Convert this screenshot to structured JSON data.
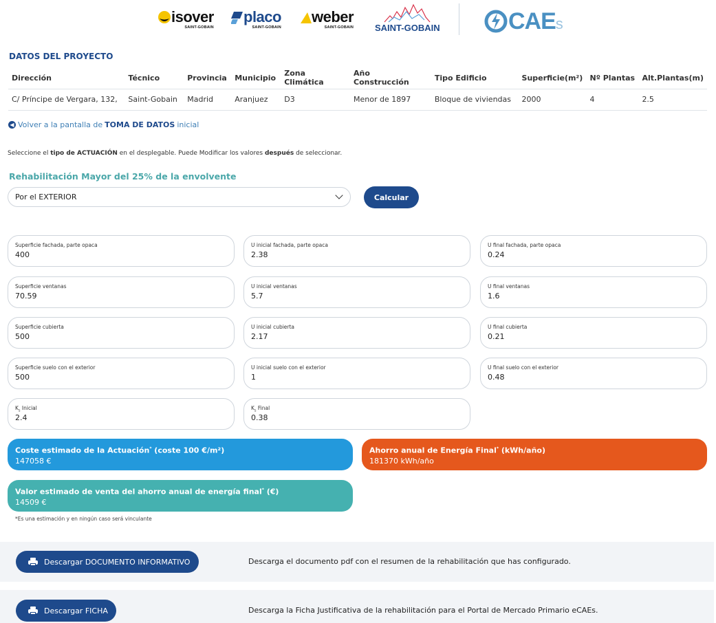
{
  "logos": {
    "isover": "isover",
    "placo": "placo",
    "weber": "weber",
    "saint_gobain_sub": "SAINT-GOBAIN",
    "saint_gobain": "SAINT-GOBAIN",
    "caes": "CAE",
    "caes_suffix": "s"
  },
  "project": {
    "title": "DATOS DEL PROYECTO",
    "headers": [
      "Dirección",
      "Técnico",
      "Provincia",
      "Municipio",
      "Zona Climática",
      "Año Construcción",
      "Tipo Edificio",
      "Superficie(m²)",
      "Nº Plantas",
      "Alt.Plantas(m)"
    ],
    "row": [
      "C/ Príncipe de Vergara, 132,",
      "Saint-Gobain",
      "Madrid",
      "Aranjuez",
      "D3",
      "Menor de 1897",
      "Bloque de viviendas",
      "2000",
      "4",
      "2.5"
    ]
  },
  "back_link": {
    "prefix": "Volver a la pantalla de",
    "bold": "TOMA DE DATOS",
    "suffix": "inicial"
  },
  "instructions": {
    "p1": "Seleccione el",
    "b1": "tipo de ACTUACIÓN",
    "p2": "en el desplegable. Puede Modificar los valores",
    "b2": "después",
    "p3": "de seleccionar."
  },
  "subtitle": "Rehabilitación Mayor del 25% de la envolvente",
  "select": {
    "value": "Por el EXTERIOR"
  },
  "calc_button": "Calcular",
  "fields": {
    "sup_fachada": {
      "label": "Superficie fachada, parte opaca",
      "value": "400"
    },
    "u_ini_fachada": {
      "label": "U inicial fachada, parte opaca",
      "value": "2.38"
    },
    "u_fin_fachada": {
      "label": "U final fachada, parte opaca",
      "value": "0.24"
    },
    "sup_ventanas": {
      "label": "Superficie ventanas",
      "value": "70.59"
    },
    "u_ini_ventanas": {
      "label": "U inicial ventanas",
      "value": "5.7"
    },
    "u_fin_ventanas": {
      "label": "U final ventanas",
      "value": "1.6"
    },
    "sup_cubierta": {
      "label": "Superficie cubierta",
      "value": "500"
    },
    "u_ini_cubierta": {
      "label": "U inicial cubierta",
      "value": "2.17"
    },
    "u_fin_cubierta": {
      "label": "U final cubierta",
      "value": "0.21"
    },
    "sup_suelo": {
      "label": "Superficie suelo con el exterior",
      "value": "500"
    },
    "u_ini_suelo": {
      "label": "U inicial suelo con el exterior",
      "value": "1"
    },
    "u_fin_suelo": {
      "label": "U final suelo con el exterior",
      "value": "0.48"
    },
    "k_ini": {
      "label_k": "K",
      "label_sub": "s",
      "label_rest": " Inicial",
      "value": "2.4"
    },
    "k_fin": {
      "label_k": "K",
      "label_sub": "s",
      "label_rest": " Final",
      "value": "0.38"
    }
  },
  "results": {
    "coste": {
      "label": "Coste estimado de la Actuación",
      "sup": "*",
      "label_suffix": " (coste 100 €/m²)",
      "value": "147058 €"
    },
    "ahorro": {
      "label": "Ahorro anual de Energía Final",
      "sup": "*",
      "label_suffix": " (kWh/año)",
      "value": "181370 kWh/año"
    },
    "valor": {
      "label": "Valor estimado de venta del ahorro anual de energía final",
      "sup": "*",
      "label_suffix": " (€)",
      "value": "14509 €"
    }
  },
  "disclaimer": "*Es una estimación y en ningún caso será vinculante",
  "downloads": {
    "doc_button": "Descargar DOCUMENTO INFORMATIVO",
    "doc_desc": "Descarga el documento pdf con el resumen de la rehabilitación que has configurado.",
    "ficha_button": "Descargar FICHA",
    "ficha_desc": "Descarga la Ficha Justificativa de la rehabilitación para el Portal de Mercado Primario eCAEs."
  },
  "colors": {
    "primary": "#1e4a8c",
    "teal": "#45b1b0",
    "blue": "#2399dc",
    "orange": "#e5581d"
  }
}
